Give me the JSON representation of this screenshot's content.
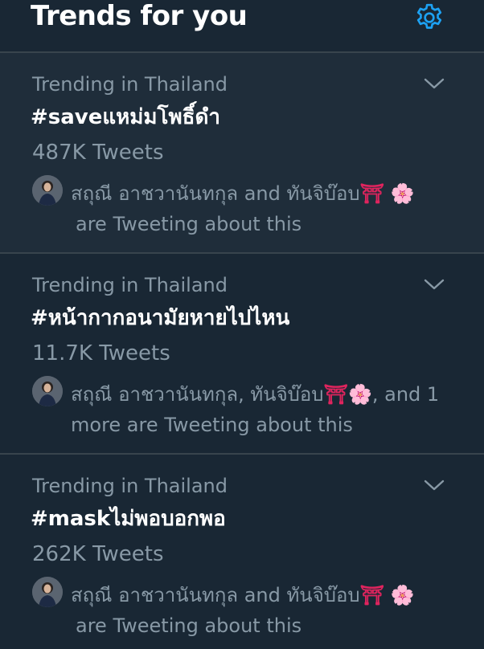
{
  "header": {
    "title": "Trends for you"
  },
  "trends": [
    {
      "context": "Trending in Thailand",
      "hashtag": "#saveแหม่มโพธิ์ดำ",
      "count": "487K Tweets",
      "social_line1": "สถุณี อาชวานันทกุล and ทันจิบ๊อบ",
      "social_line2": "are Tweeting about this",
      "emoji": [
        "⛩",
        "🌸"
      ]
    },
    {
      "context": "Trending in Thailand",
      "hashtag": "#หน้ากากอนามัยหายไปไหน",
      "count": "11.7K Tweets",
      "social_line1": "สถุณี อาชวานันทกุล, ทันจิบ๊อบ",
      "social_line1_suffix": ", and 1",
      "social_line2": "more are Tweeting about this",
      "emoji": [
        "⛩",
        "🌸"
      ]
    },
    {
      "context": "Trending in Thailand",
      "hashtag": "#maskไม่พอบอกพอ",
      "count": "262K Tweets",
      "social_line1": "สถุณี อาชวานันทกุล and ทันจิบ๊อบ",
      "social_line2": "are Tweeting about this",
      "emoji": [
        "⛩",
        "🌸"
      ]
    }
  ],
  "icons": {
    "settings": "gear-icon",
    "caret": "chevron-down-icon"
  },
  "colors": {
    "background": "#15202b",
    "panel": "#192734",
    "accent": "#1da1f2",
    "secondary_text": "#8899a6",
    "divider": "#38444d"
  }
}
